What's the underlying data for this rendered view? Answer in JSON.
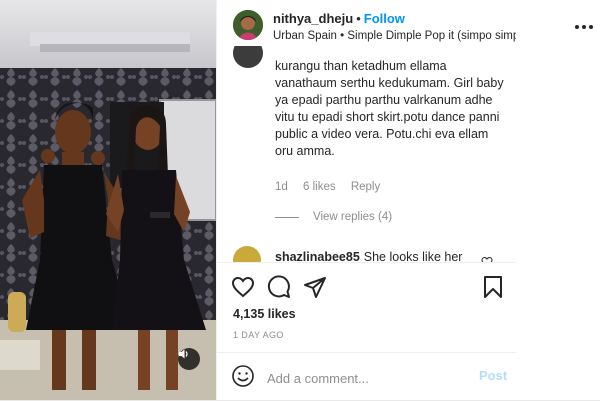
{
  "post": {
    "username": "nithya_dheju",
    "separator": "•",
    "follow_label": "Follow",
    "location": "Urban Spain • Simple Dimple Pop it (simpo simpo #tiktok)"
  },
  "comments": {
    "first": {
      "text": "kurangu than ketadhum ellama vanathaum serthu kedukumam. Girl baby ya epadi parthu parthu valrkanum adhe vitu tu epadi short skirt.potu dance panni public a video vera. Potu.chi eva ellam oru amma.",
      "age": "1d",
      "likes": "6 likes",
      "reply_label": "Reply",
      "view_replies": "View replies (4)"
    },
    "second": {
      "username": "shazlinabee85",
      "text": "She looks like her"
    }
  },
  "actions": {
    "likes_count": "4,135 likes",
    "timestamp": "1 DAY AGO"
  },
  "add_comment": {
    "placeholder": "Add a comment...",
    "post_label": "Post"
  },
  "icons": {
    "like": "heart-icon",
    "comment": "comment-icon",
    "share": "share-icon",
    "save": "bookmark-icon",
    "options": "more-options-icon",
    "sound": "speaker-icon",
    "emoji": "emoji-icon"
  },
  "colors": {
    "accent": "#0095f6",
    "post_disabled": "#b2dffc",
    "text": "#262626",
    "muted": "#8e8e8e"
  }
}
